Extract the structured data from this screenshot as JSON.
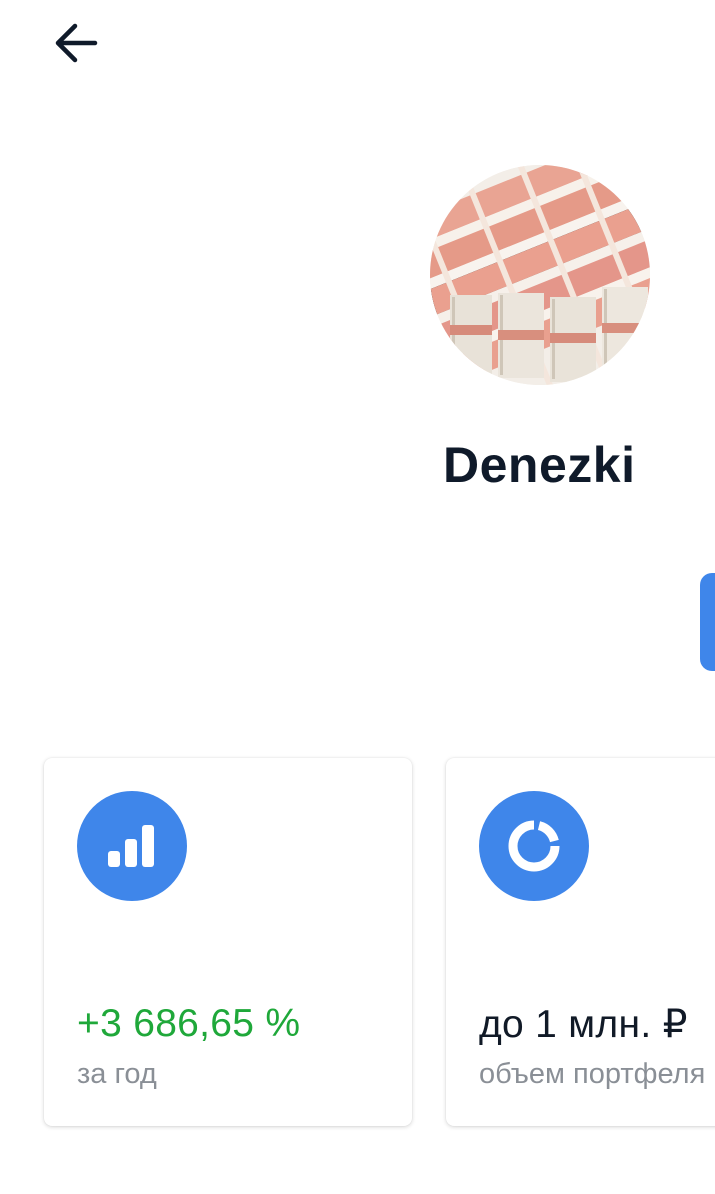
{
  "header": {
    "back_icon": "arrow-left-icon"
  },
  "profile": {
    "avatar_description_icon": "money-stack-avatar",
    "name": "Denezki"
  },
  "colors": {
    "accent": "#3f86ea",
    "positive": "#1fa83a",
    "text_primary": "#0f1a2a",
    "text_secondary": "#8a8f96"
  },
  "stats": [
    {
      "icon": "bar-chart-icon",
      "value": "+3 686,65 %",
      "caption": "за год"
    },
    {
      "icon": "pie-chart-icon",
      "value": "до 1 млн. ₽",
      "caption": "объем портфеля"
    }
  ]
}
